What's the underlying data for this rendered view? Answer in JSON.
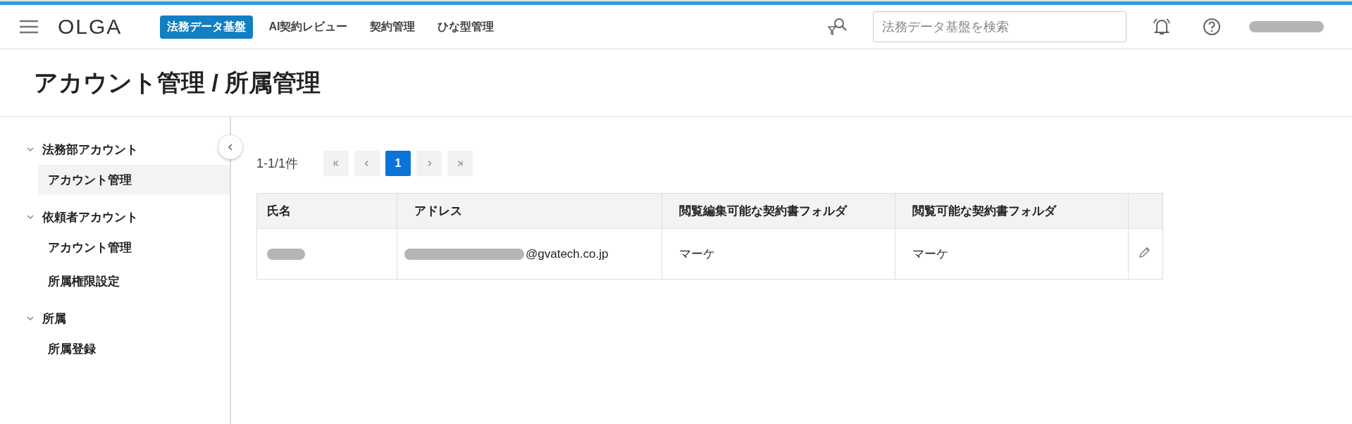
{
  "header": {
    "logo": "OLGA",
    "nav": [
      {
        "label": "法務データ基盤",
        "selected": true
      },
      {
        "label": "AI契約レビュー",
        "selected": false
      },
      {
        "label": "契約管理",
        "selected": false
      },
      {
        "label": "ひな型管理",
        "selected": false
      }
    ],
    "search": {
      "placeholder": "法務データ基盤を検索"
    }
  },
  "page_title": "アカウント管理 / 所属管理",
  "sidebar": {
    "groups": [
      {
        "label": "法務部アカウント",
        "expanded": true,
        "children": [
          {
            "label": "アカウント管理",
            "selected": true
          }
        ]
      },
      {
        "label": "依頼者アカウント",
        "expanded": true,
        "children": [
          {
            "label": "アカウント管理",
            "selected": false
          },
          {
            "label": "所属権限設定",
            "selected": false
          }
        ]
      },
      {
        "label": "所属",
        "expanded": true,
        "children": [
          {
            "label": "所属登録",
            "selected": false
          }
        ]
      }
    ]
  },
  "pagination": {
    "summary": "1-1/1件",
    "pages": [
      {
        "label": "1",
        "selected": true
      }
    ]
  },
  "table": {
    "columns": [
      "氏名",
      "アドレス",
      "閲覧編集可能な契約書フォルダ",
      "閲覧可能な契約書フォルダ"
    ],
    "rows": [
      {
        "address_domain": "@gvatech.co.jp",
        "editable_folder": "マーケ",
        "viewable_folder": "マーケ"
      }
    ]
  }
}
